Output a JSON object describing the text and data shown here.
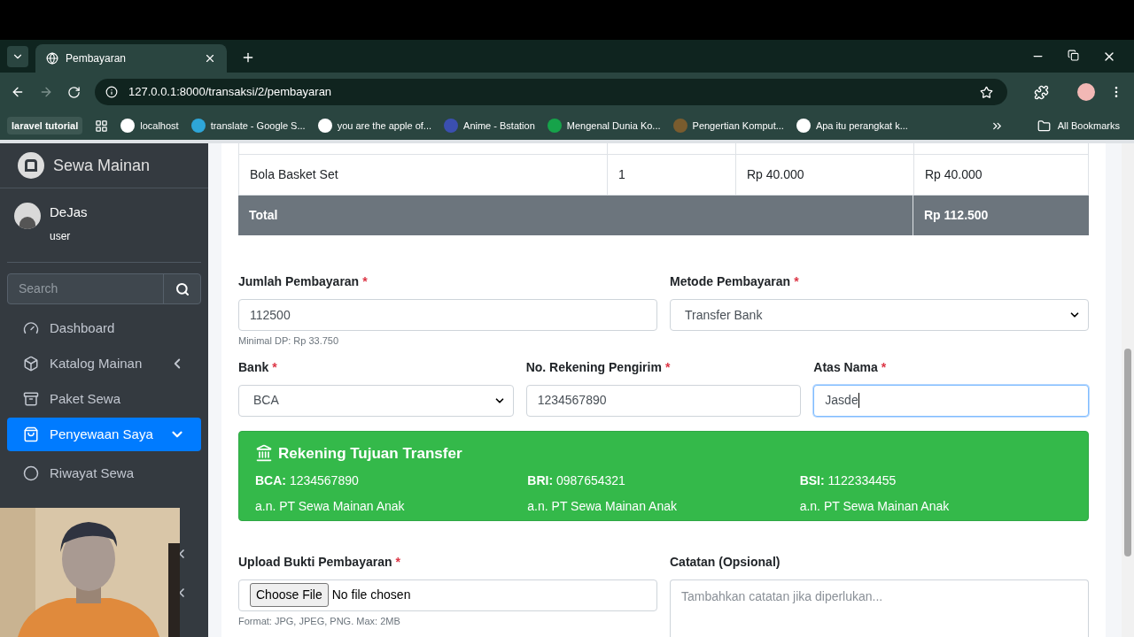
{
  "browser": {
    "tab_title": "Pembayaran",
    "url": "127.0.0.1:8000/transaksi/2/pembayaran",
    "bookmarks": [
      {
        "kind": "group",
        "label": "laravel tutorial"
      },
      {
        "kind": "apps"
      },
      {
        "kind": "link",
        "label": "localhost"
      },
      {
        "kind": "link",
        "label": "translate - Google S..."
      },
      {
        "kind": "link",
        "label": "you are the apple of..."
      },
      {
        "kind": "link",
        "label": "Anime - Bstation"
      },
      {
        "kind": "link",
        "label": "Mengenal Dunia Ko..."
      },
      {
        "kind": "link",
        "label": "Pengertian Komput..."
      },
      {
        "kind": "link",
        "label": "Apa itu perangkat k..."
      }
    ],
    "all_bookmarks": "All Bookmarks"
  },
  "sidebar": {
    "brand": "Sewa Mainan",
    "user": {
      "name": "DeJas",
      "role": "user"
    },
    "search": {
      "placeholder": "Search"
    },
    "items": [
      {
        "label": "Dashboard",
        "selected": false
      },
      {
        "label": "Katalog Mainan",
        "selected": false,
        "expanded": false
      },
      {
        "label": "Paket Sewa",
        "selected": false
      },
      {
        "label": "Penyewaan Saya",
        "selected": true,
        "expanded": true,
        "children": [
          {
            "label": "Riwayat Sewa",
            "selected": false
          }
        ]
      }
    ]
  },
  "table": {
    "rows": [
      {
        "cells": [
          "Bola Basket Set",
          "1",
          "Rp 40.000",
          "Rp 40.000"
        ]
      }
    ],
    "total": {
      "label": "Total",
      "value": "Rp 112.500"
    }
  },
  "payment_rows": [
    {
      "fields": [
        {
          "kind": "input",
          "label": "Jumlah Pembayaran",
          "required_mark": "*",
          "value": "112500",
          "help": "Minimal DP: Rp 33.750",
          "focused": false
        },
        {
          "kind": "select",
          "label": "Metode Pembayaran",
          "required_mark": "*",
          "value": "Transfer Bank",
          "focused": false
        }
      ]
    },
    {
      "fields": [
        {
          "kind": "select",
          "label": "Bank",
          "required_mark": "*",
          "value": "BCA",
          "focused": false
        },
        {
          "kind": "input",
          "label": "No. Rekening Pengirim",
          "required_mark": "*",
          "value": "1234567890",
          "focused": false
        },
        {
          "kind": "input",
          "label": "Atas Nama",
          "required_mark": "*",
          "value": "Jasde",
          "focused": true
        }
      ]
    }
  ],
  "transfer_info": {
    "title": "Rekening Tujuan Transfer",
    "accounts": [
      {
        "bank": "BCA:",
        "number": "1234567890",
        "holder": "a.n. PT Sewa Mainan Anak"
      },
      {
        "bank": "BRI:",
        "number": "0987654321",
        "holder": "a.n. PT Sewa Mainan Anak"
      },
      {
        "bank": "BSI:",
        "number": "1122334455",
        "holder": "a.n. PT Sewa Mainan Anak"
      }
    ]
  },
  "upload_row": {
    "fields": [
      {
        "kind": "file",
        "label": "Upload Bukti Pembayaran",
        "required_mark": "*",
        "button": "Choose File",
        "value": "No file chosen",
        "help": "Format: JPG, JPEG, PNG. Max: 2MB",
        "focused": false
      },
      {
        "kind": "textarea",
        "label": "Catatan (Opsional)",
        "placeholder": "Tambahkan catatan jika diperlukan...",
        "focused": false
      }
    ]
  }
}
